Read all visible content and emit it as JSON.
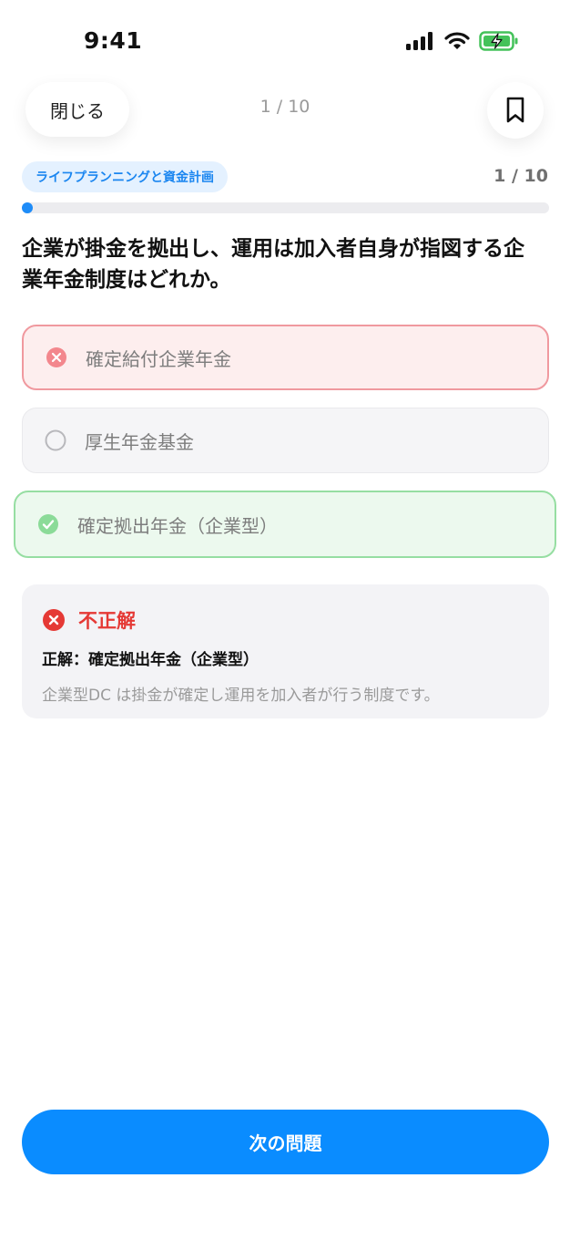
{
  "status_bar": {
    "time": "9:41"
  },
  "header": {
    "close_label": "閉じる",
    "progress": "1 / 10"
  },
  "quiz": {
    "category": "ライフプランニングと資金計画",
    "counter": "1 / 10",
    "progress_fraction": 0.1,
    "question": "企業が掛金を拠出し、運用は加入者自身が指図する企業年金制度はどれか。",
    "options": [
      {
        "label": "確定給付企業年金",
        "state": "wrong"
      },
      {
        "label": "厚生年金基金",
        "state": "neutral"
      },
      {
        "label": "確定拠出年金（企業型）",
        "state": "correct"
      }
    ]
  },
  "result": {
    "title": "不正解",
    "correct_answer": "正解：確定拠出年金（企業型）",
    "explanation": "企業型DC は掛金が確定し運用を加入者が行う制度です。"
  },
  "footer": {
    "next_label": "次の問題"
  },
  "colors": {
    "accent": "#0a8cff",
    "wrong": "#e53935",
    "correct": "#4cc266"
  }
}
